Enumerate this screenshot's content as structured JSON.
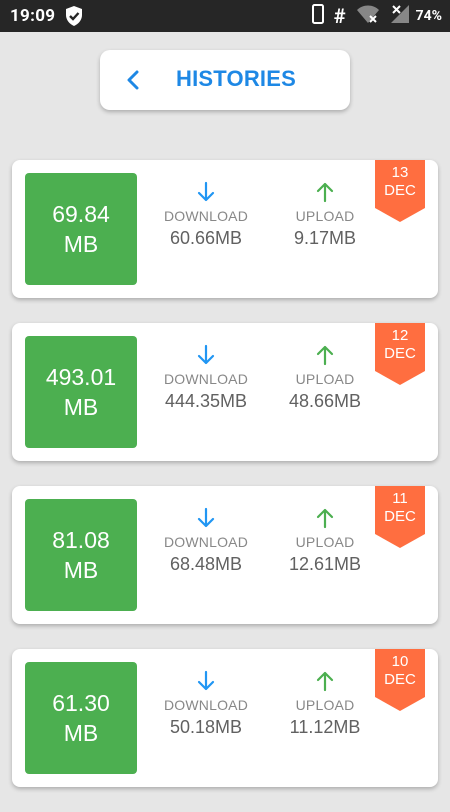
{
  "status_bar": {
    "time": "19:09",
    "battery_percent": "74%",
    "icons": [
      "shield-check-icon",
      "phone-outline-icon",
      "hash-icon",
      "wifi-off-icon",
      "signal-icon",
      "battery-icon"
    ]
  },
  "header": {
    "title": "HISTORIES",
    "back_icon": "chevron-left-icon"
  },
  "labels": {
    "download": "DOWNLOAD",
    "upload": "UPLOAD"
  },
  "colors": {
    "accent_blue": "#1e88e5",
    "total_green": "#4caf50",
    "upload_green": "#4caf50",
    "download_blue": "#2196f3",
    "badge_orange": "#ff6e40"
  },
  "histories": [
    {
      "total_value": "69.84",
      "total_unit": "MB",
      "download": "60.66MB",
      "upload": "9.17MB",
      "day": "13",
      "month": "DEC"
    },
    {
      "total_value": "493.01",
      "total_unit": "MB",
      "download": "444.35MB",
      "upload": "48.66MB",
      "day": "12",
      "month": "DEC"
    },
    {
      "total_value": "81.08",
      "total_unit": "MB",
      "download": "68.48MB",
      "upload": "12.61MB",
      "day": "11",
      "month": "DEC"
    },
    {
      "total_value": "61.30",
      "total_unit": "MB",
      "download": "50.18MB",
      "upload": "11.12MB",
      "day": "10",
      "month": "DEC"
    }
  ]
}
